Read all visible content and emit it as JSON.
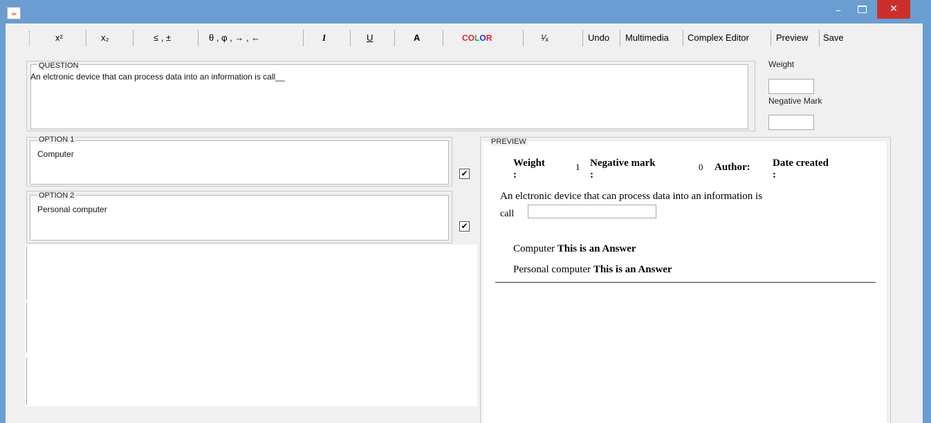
{
  "window": {
    "minimize_glyph": "–",
    "maximize_glyph": "",
    "close_glyph": "✕"
  },
  "toolbar": {
    "superscript": "x²",
    "subscript": "x₂",
    "symbols_math": "≤ , ±",
    "symbols_greek": "θ , φ , → , ←",
    "italic": "I",
    "underline": "U",
    "bold": "A",
    "color": [
      "C",
      "O",
      "L",
      "O",
      "R"
    ],
    "color_hex": [
      "#e0202a",
      "#e0202a",
      "#1ab02a",
      "#2030e0",
      "#e0202a"
    ],
    "fraction": "¹⁄ₓ",
    "undo": "Undo",
    "multimedia": "Multimedia",
    "complex_editor": "Complex Editor",
    "preview": "Preview",
    "save": "Save"
  },
  "question": {
    "legend": "QUESTION",
    "text": "An elctronic device that can process data into an information is call__"
  },
  "side": {
    "weight_label": "Weight",
    "weight_value": "",
    "negative_label": "Negative Mark",
    "negative_value": ""
  },
  "options": [
    {
      "legend": "OPTION 1",
      "text": "Computer",
      "checked": "✔"
    },
    {
      "legend": "OPTION 2",
      "text": "Personal computer",
      "checked": "✔"
    }
  ],
  "preview": {
    "legend": "PREVIEW",
    "weight_label": "Weight",
    "weight_value": "1",
    "negative_label": "Negative mark",
    "negative_value": "0",
    "author_label": "Author:",
    "date_label": "Date created",
    "colon": ":",
    "question_line1": "An elctronic device that can process data into an information is",
    "question_line2": "call",
    "answers": [
      {
        "text": "Computer",
        "badge": "This is an Answer"
      },
      {
        "text": "Personal computer",
        "badge": "This is an Answer"
      }
    ]
  }
}
